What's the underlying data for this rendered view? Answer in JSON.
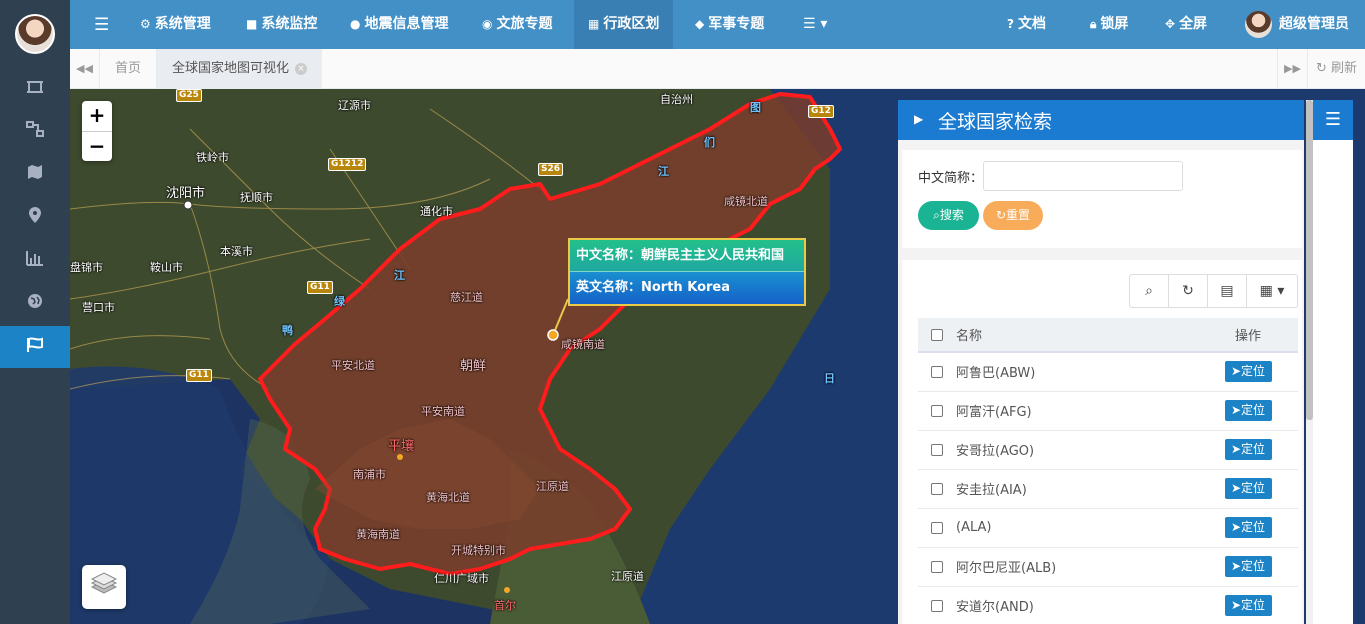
{
  "topbar": {
    "menu_icon": "bars-icon",
    "items": [
      {
        "icon": "gear-icon",
        "label": "系统管理"
      },
      {
        "icon": "video-icon",
        "label": "系统监控"
      },
      {
        "icon": "map-marker-icon",
        "label": "地震信息管理"
      },
      {
        "icon": "globe-icon",
        "label": "文旅专题"
      },
      {
        "icon": "bank-icon",
        "label": "行政区划"
      },
      {
        "icon": "shield-icon",
        "label": "军事专题"
      }
    ],
    "more_icon": "list-icon",
    "right": [
      {
        "icon": "question-icon",
        "label": "文档"
      },
      {
        "icon": "lock-icon",
        "label": "锁屏"
      },
      {
        "icon": "expand-icon",
        "label": "全屏"
      }
    ],
    "user_name": "超级管理员"
  },
  "tabs": {
    "home": "首页",
    "active": "全球国家地图可视化",
    "refresh": "刷新"
  },
  "map": {
    "labels": {
      "liaoyuan": "辽源市",
      "zizhizhou": "自治州",
      "tieling": "铁岭市",
      "shenyang": "沈阳市",
      "fushun": "抚顺市",
      "tonghua": "通化市",
      "benxi": "本溪市",
      "panjin": "盘锦市",
      "anshan": "鞍山市",
      "yingkou": "营口市",
      "cigang": "慈江道",
      "hambuk": "咸镜北道",
      "hamnam": "咸镜南道",
      "pyongbuk": "平安北道",
      "chaoxian": "朝鲜",
      "pyongnam": "平安南道",
      "pyongyang": "平壤",
      "nampho": "南浦市",
      "hwangbuk": "黄海北道",
      "gangwon": "江原道",
      "hwangnam": "黄海南道",
      "kaesong": "开城特别市",
      "incheon": "仁川广域市",
      "gangwon_s": "江原道",
      "seoul": "首尔",
      "yalu1": "鸭",
      "yalu2": "绿",
      "yalu3": "江",
      "tumen1": "图",
      "tumen2": "们",
      "tumen3": "江",
      "sea": "日"
    },
    "roads": {
      "g25": "G25",
      "g1212": "G1212",
      "s26": "S26",
      "g11a": "G11",
      "g11b": "G11",
      "g12": "G12"
    },
    "zoom_in": "+",
    "zoom_out": "−",
    "layers_icon": "layers-icon"
  },
  "popup": {
    "cn": "中文名称：朝鲜民主主义人民共和国",
    "en": "英文名称：North Korea"
  },
  "panel": {
    "title": "全球国家检索",
    "search_label": "中文简称：",
    "search_value": "",
    "search_btn": "搜索",
    "reset_btn": "重置",
    "columns": {
      "name": "名称",
      "op": "操作"
    },
    "locate_label": "定位",
    "rows": [
      {
        "name": "阿鲁巴(ABW)"
      },
      {
        "name": "阿富汗(AFG)"
      },
      {
        "name": "安哥拉(AGO)"
      },
      {
        "name": "安圭拉(AIA)"
      },
      {
        "name": "(ALA)"
      },
      {
        "name": "阿尔巴尼亚(ALB)"
      },
      {
        "name": "安道尔(AND)"
      }
    ]
  }
}
